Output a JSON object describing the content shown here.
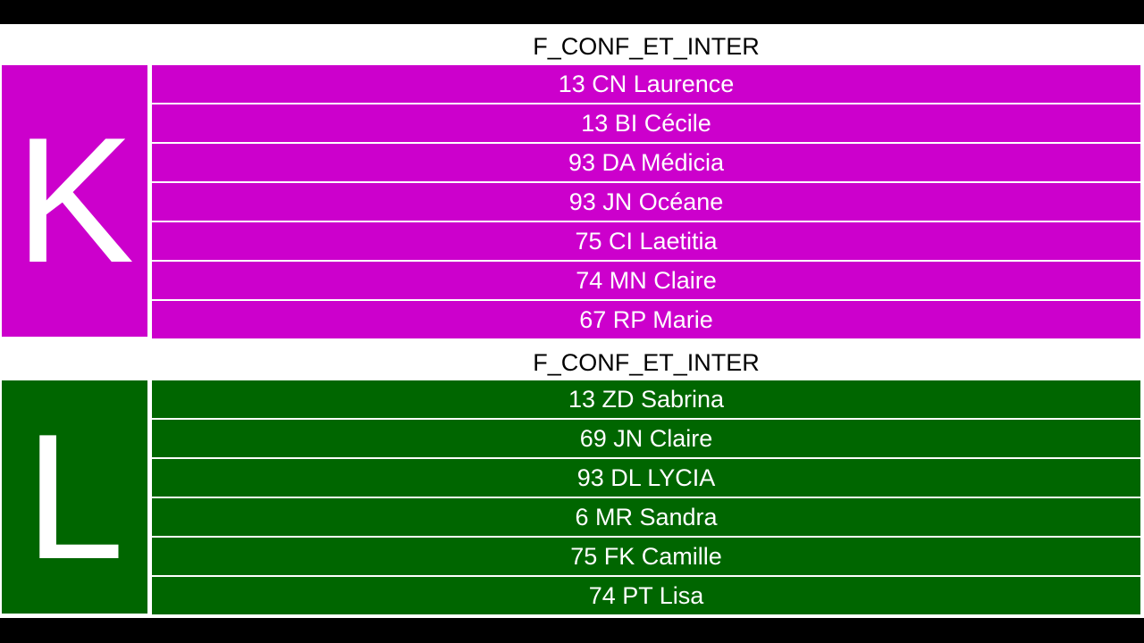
{
  "pools": [
    {
      "title": "F_CONF_ET_INTER",
      "letter": "K",
      "color": "#cc00cc",
      "entries": [
        "13 CN Laurence",
        "13 BI Cécile",
        "93 DA Médicia",
        "93 JN Océane",
        "75 CI Laetitia",
        "74 MN Claire",
        "67 RP Marie"
      ]
    },
    {
      "title": "F_CONF_ET_INTER",
      "letter": "L",
      "color": "#006600",
      "entries": [
        "13 ZD Sabrina",
        "69 JN Claire",
        "93 DL LYCIA",
        "6 MR Sandra",
        "75 FK Camille",
        "74 PT Lisa"
      ]
    }
  ]
}
